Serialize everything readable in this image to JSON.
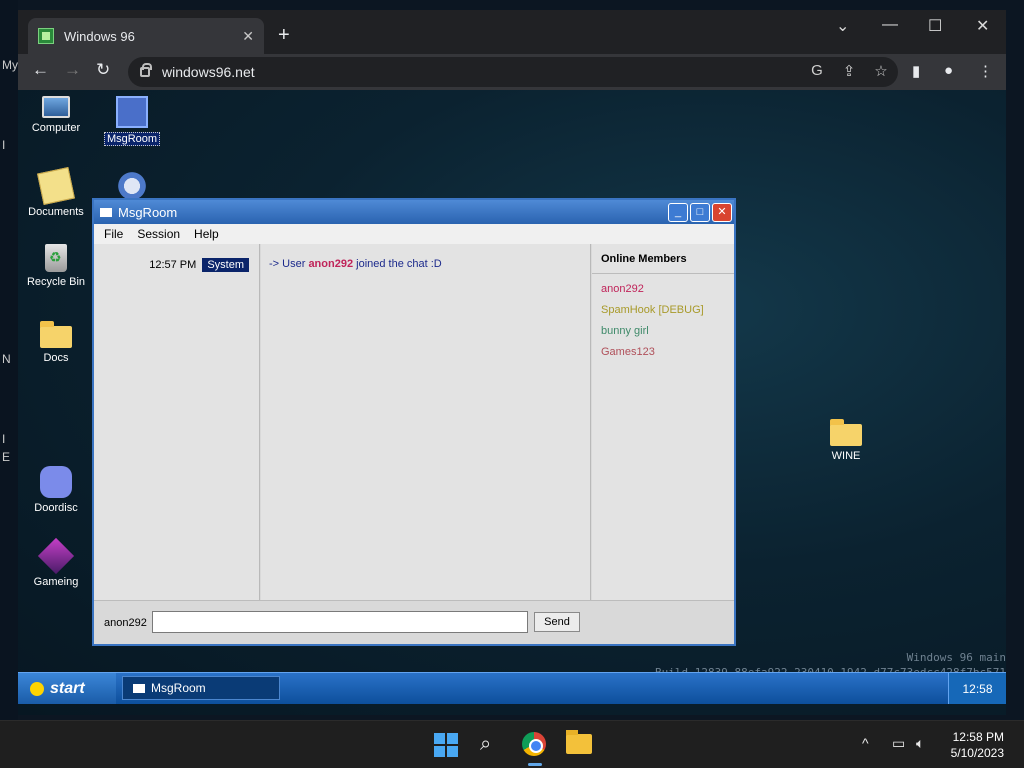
{
  "host": {
    "left_fragments": [
      "My",
      "I",
      "N",
      "I",
      "E"
    ],
    "taskbar": {
      "clock_time": "12:58 PM",
      "clock_date": "5/10/2023",
      "tray_chevron": "^"
    }
  },
  "browser": {
    "tab_title": "Windows 96",
    "tab_close": "✕",
    "new_tab": "+",
    "url": "windows96.net",
    "window_controls": {
      "dropdown": "⌄",
      "minimize": "—",
      "maximize": "☐",
      "close": "✕"
    },
    "nav": {
      "back": "←",
      "forward": "→",
      "reload": "↻"
    }
  },
  "desktop": {
    "icons_left": [
      {
        "label": "Computer"
      },
      {
        "label": "Documents"
      },
      {
        "label": "Recycle Bin"
      },
      {
        "label": "Docs"
      },
      {
        "label": "Doordisc"
      },
      {
        "label": "Gameing"
      }
    ],
    "icon_msgroom": "MsgRoom",
    "icon_wine": "WINE",
    "watermark_line1": "Windows 96 main",
    "watermark_line2": "Build 12839.88efa922.230410-1942.d77c73edcc428f7bc571"
  },
  "w96_taskbar": {
    "start_label": "start",
    "task_label": "MsgRoom",
    "clock": "12:58"
  },
  "msgroom": {
    "title": "MsgRoom",
    "menu": [
      "File",
      "Session",
      "Help"
    ],
    "messages": [
      {
        "time": "12:57 PM",
        "sender": "System",
        "prefix": "-> User ",
        "user": "anon292",
        "suffix": " joined the chat :D"
      }
    ],
    "members_header": "Online Members",
    "members": [
      {
        "name": "anon292",
        "color": "#c0245a"
      },
      {
        "name": "SpamHook [DEBUG]",
        "color": "#a89a2a"
      },
      {
        "name": "bunny girl",
        "color": "#3f8a6a"
      },
      {
        "name": "Games123",
        "color": "#b0505a"
      }
    ],
    "nick": "anon292",
    "input_value": "",
    "send_label": "Send"
  }
}
